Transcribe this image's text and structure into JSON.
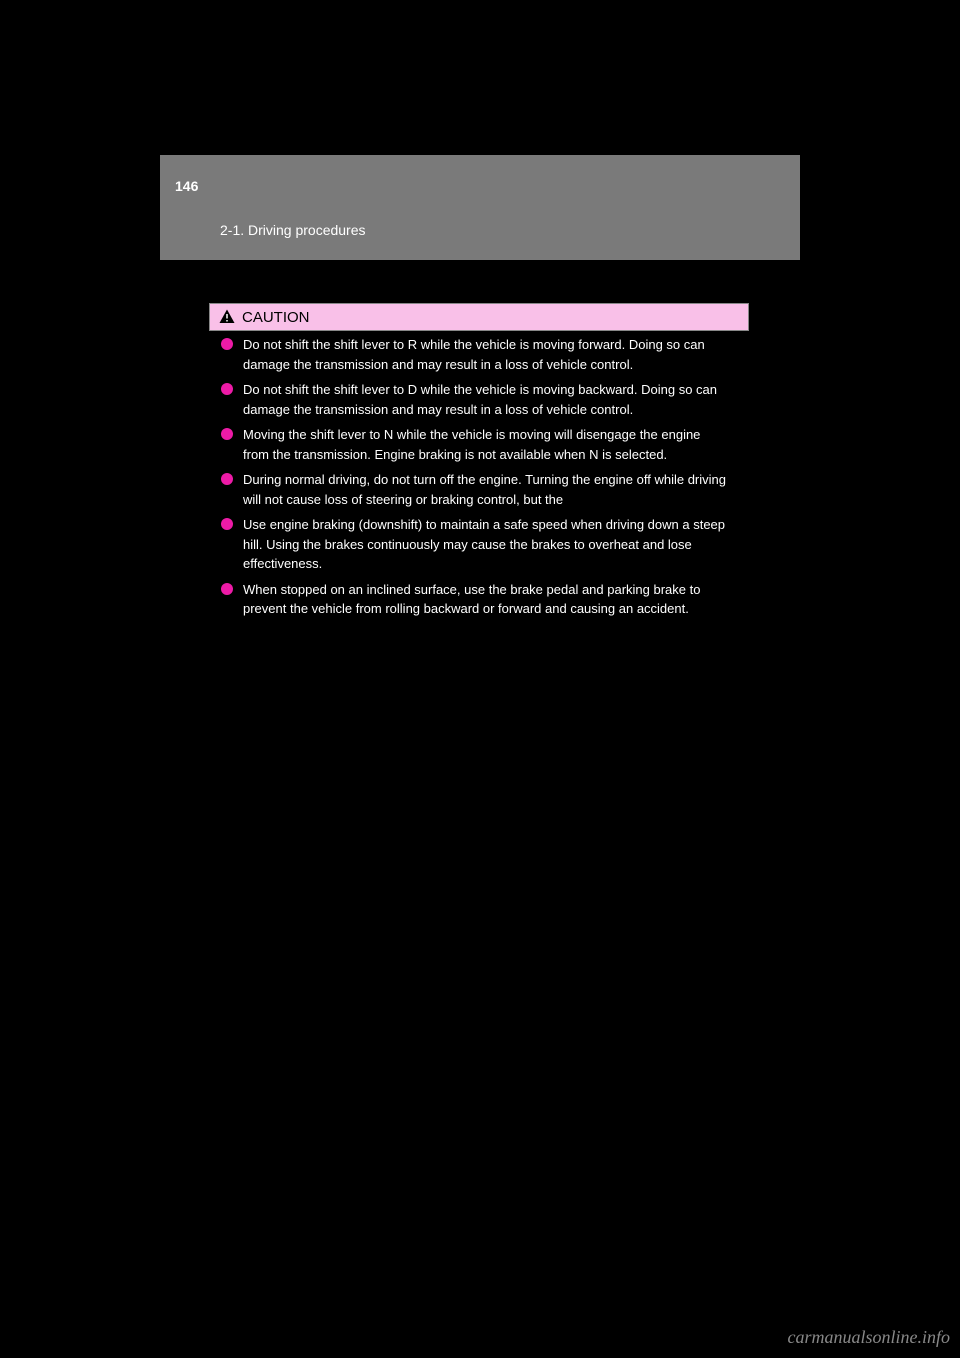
{
  "header": {
    "page_number": "146",
    "section": "2-1. Driving procedures"
  },
  "caution": {
    "label": "CAUTION"
  },
  "bullets": [
    {
      "text": "Do not shift the shift lever to R while the vehicle is moving forward. Doing so can damage the transmission and may result in a loss of vehicle control."
    },
    {
      "text": "Do not shift the shift lever to D while the vehicle is moving backward. Doing so can damage the transmission and may result in a loss of vehicle control."
    },
    {
      "text": "Moving the shift lever to N while the vehicle is moving will disengage the engine from the transmission. Engine braking is not available when N is selected."
    },
    {
      "text": "During normal driving, do not turn off the engine. Turning the engine off while driving will not cause loss of steering or braking control, but the"
    },
    {
      "text": "Use engine braking (downshift) to maintain a safe speed when driving down a steep hill. Using the brakes continuously may cause the brakes to overheat and lose effectiveness."
    },
    {
      "text": "When stopped on an inclined surface, use the brake pedal and parking brake to prevent the vehicle from rolling backward or forward and causing an accident."
    }
  ],
  "watermark": "carmanualsonline.info"
}
